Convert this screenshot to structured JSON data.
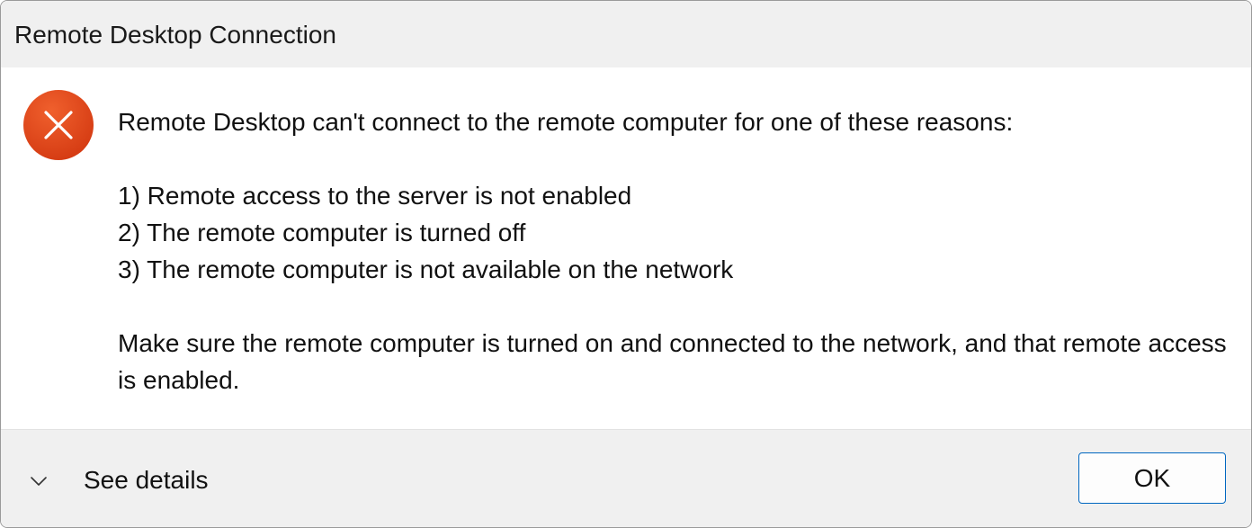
{
  "window": {
    "title": "Remote Desktop Connection"
  },
  "message": {
    "heading": "Remote Desktop can't connect to the remote computer for one of these reasons:",
    "reasons": [
      "1) Remote access to the server is not enabled",
      "2) The remote computer is turned off",
      "3) The remote computer is not available on the network"
    ],
    "advice": "Make sure the remote computer is turned on and connected to the network, and that remote access is enabled."
  },
  "icons": {
    "error": "error-x-icon",
    "details_chevron": "chevron-down-icon"
  },
  "footer": {
    "details_label": "See details",
    "ok_label": "OK"
  },
  "colors": {
    "error_red": "#e2441b",
    "accent_border": "#0067c0"
  }
}
